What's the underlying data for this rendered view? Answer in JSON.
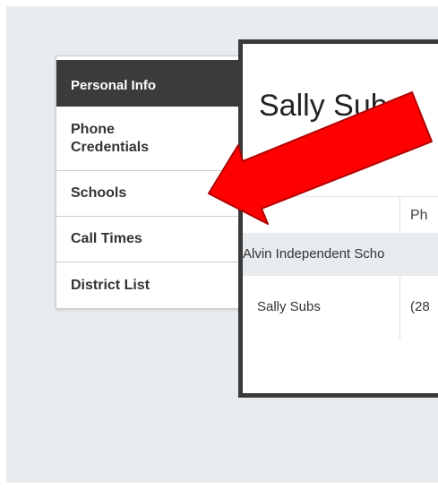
{
  "sidebar": {
    "items": [
      {
        "label": "Personal Info",
        "active": true
      },
      {
        "label": "Phone Credentials",
        "active": false
      },
      {
        "label": "Schools",
        "active": false
      },
      {
        "label": "Call Times",
        "active": false
      },
      {
        "label": "District List",
        "active": false
      }
    ]
  },
  "modal": {
    "title": "Sally Subs",
    "column_header_partial": "Ph",
    "group_row": "Alvin Independent Scho",
    "row": {
      "name": "Sally Subs",
      "phone_partial": "(28"
    }
  },
  "annotation": {
    "arrow_color": "#ff0000",
    "arrow_target": "Schools"
  },
  "colors": {
    "active_tab": "#3b3b3b",
    "page_background": "#e9ecef",
    "modal_border": "#3a3a3a"
  }
}
